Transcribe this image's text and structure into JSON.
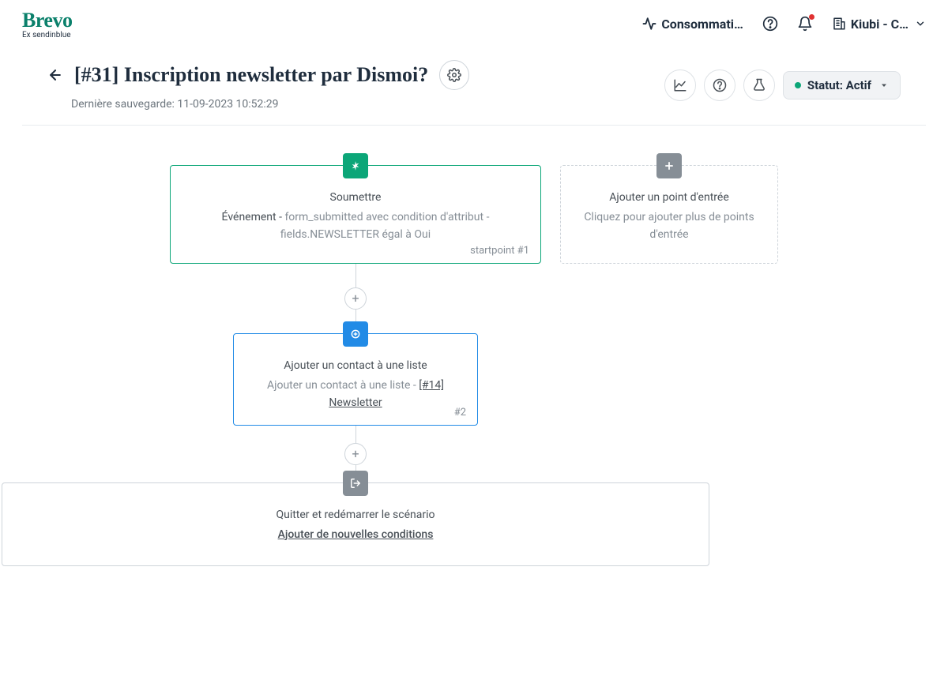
{
  "brand": {
    "name": "Brevo",
    "tagline": "Ex sendinblue"
  },
  "topbar": {
    "consumption_label": "Consommati…",
    "org_label": "Kiubi - C…"
  },
  "page": {
    "title": "[#31] Inscription newsletter par Dismoi?",
    "last_save_label": "Dernière sauvegarde: 11-09-2023 10:52:29",
    "status_label": "Statut: Actif"
  },
  "flow": {
    "start": {
      "title": "Soumettre",
      "line1_prefix": "Événement - ",
      "line1_suffix": "form_submitted avec condition d'attribut - fields.NEWSLETTER égal à Oui",
      "tag": "startpoint #1"
    },
    "add_entry": {
      "title": "Ajouter un point d'entrée",
      "subtitle": "Cliquez pour ajouter plus de points d'entrée"
    },
    "add_contact": {
      "title": "Ajouter un contact à une liste",
      "line_prefix": "Ajouter un contact à une liste - ",
      "line_link": "[#14] Newsletter",
      "tag": "#2"
    },
    "exit": {
      "title": "Quitter et redémarrer le scénario",
      "link": "Ajouter de nouvelles conditions"
    }
  }
}
